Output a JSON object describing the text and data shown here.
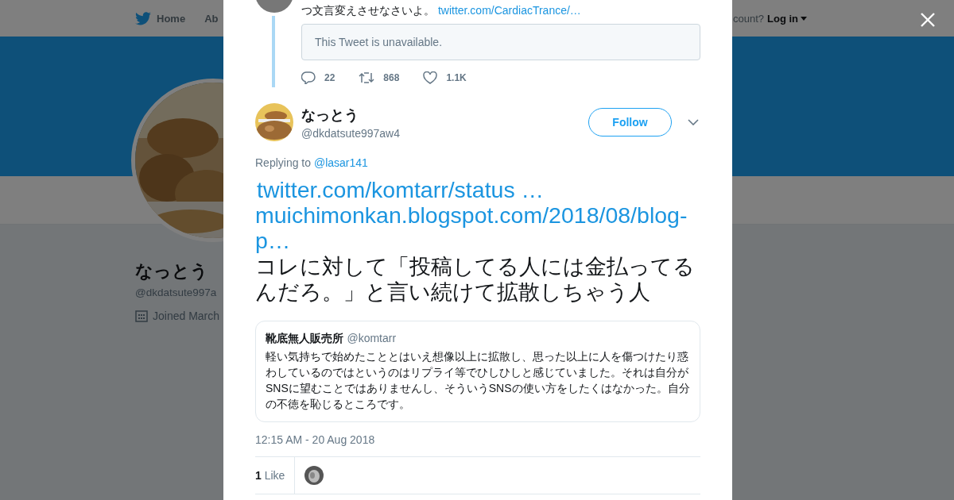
{
  "background_page": {
    "nav": [
      {
        "label": "Home",
        "kind": "home"
      },
      {
        "label": "Ab",
        "kind": "plain"
      }
    ],
    "account_prompt": "count?",
    "login": "Log in",
    "profile": {
      "name": "なっとう",
      "handle": "@dkdatsute997a",
      "joined": "Joined March"
    }
  },
  "thread_tweet": {
    "text": "つ文言変えさせなさいよ。",
    "link": "twitter.com/CardiacTrance/…",
    "unavailable": "This Tweet is unavailable.",
    "actions": [
      {
        "kind": "reply",
        "count": "22"
      },
      {
        "kind": "retweet",
        "count": "868"
      },
      {
        "kind": "like",
        "count": "1.1K"
      }
    ]
  },
  "tweet": {
    "name": "なっとう",
    "handle": "@dkdatsute997aw4",
    "follow": "Follow",
    "replying_label": "Replying to",
    "replying_to": "@lasar141",
    "links": [
      "twitter.com/komtarr/status …",
      "muichimonkan.blogspot.com/2018/08/blog-p…"
    ],
    "text": "コレに対して「投稿してる人には金払ってるんだろ。」と言い続けて拡散しちゃう人",
    "quote": {
      "name": "靴底無人販売所",
      "handle": "@komtarr",
      "text": "軽い気持ちで始めたこととはいえ想像以上に拡散し、思った以上に人を傷つけたり惑わしているのではというのはリプライ等でひしひしと感じていました。それは自分がSNSに望むことではありませんし、そういうSNSの使い方をしたくはなかった。自分の不徳を恥じるところです。"
    },
    "timestamp": "12:15 AM - 20 Aug 2018",
    "likes_count": "1",
    "likes_label": "Like"
  }
}
